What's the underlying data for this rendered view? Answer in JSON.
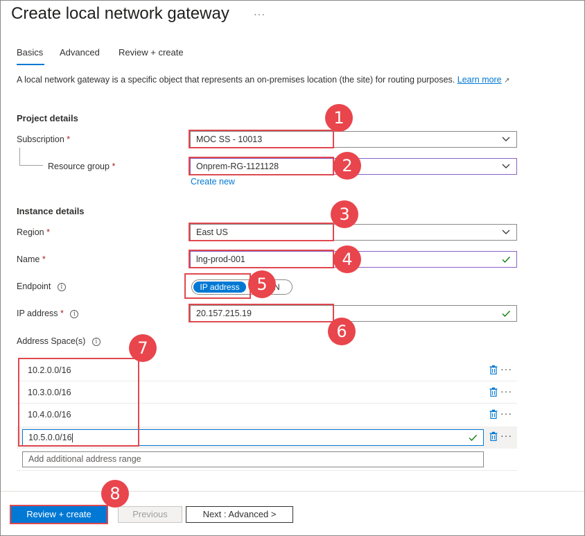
{
  "page": {
    "title": "Create local network gateway",
    "more_label": "···"
  },
  "tabs": [
    {
      "label": "Basics"
    },
    {
      "label": "Advanced"
    },
    {
      "label": "Review + create"
    }
  ],
  "description": {
    "text": "A local network gateway is a specific object that represents an on-premises location (the site) for routing purposes.",
    "link_label": "Learn more"
  },
  "project_details": {
    "heading": "Project details",
    "subscription": {
      "label": "Subscription",
      "value": "MOC SS - 10013"
    },
    "resource_group": {
      "label": "Resource group",
      "value": "Onprem-RG-1121128",
      "create_new": "Create new"
    }
  },
  "instance_details": {
    "heading": "Instance details",
    "region": {
      "label": "Region",
      "value": "East US"
    },
    "name": {
      "label": "Name",
      "value": "lng-prod-001"
    },
    "endpoint": {
      "label": "Endpoint",
      "selected": "IP address",
      "other": "N"
    },
    "ip_address": {
      "label": "IP address",
      "value": "20.157.215.19"
    },
    "address_space": {
      "label": "Address Space(s)",
      "entries": [
        "10.2.0.0/16",
        "10.3.0.0/16",
        "10.4.0.0/16",
        "10.5.0.0/16"
      ],
      "add_placeholder": "Add additional address range"
    }
  },
  "required_mark": "*",
  "info_icon": "i",
  "more_actions": "···",
  "badges": [
    "1",
    "2",
    "3",
    "4",
    "5",
    "6",
    "7",
    "8"
  ],
  "footer": {
    "review_create": "Review + create",
    "previous": "Previous",
    "next": "Next : Advanced >"
  },
  "colors": {
    "accent": "#0078d4",
    "highlight": "#e0474e",
    "badge": "#e9454c",
    "valid_check": "#107c10",
    "focus_purple": "#8661c5"
  }
}
